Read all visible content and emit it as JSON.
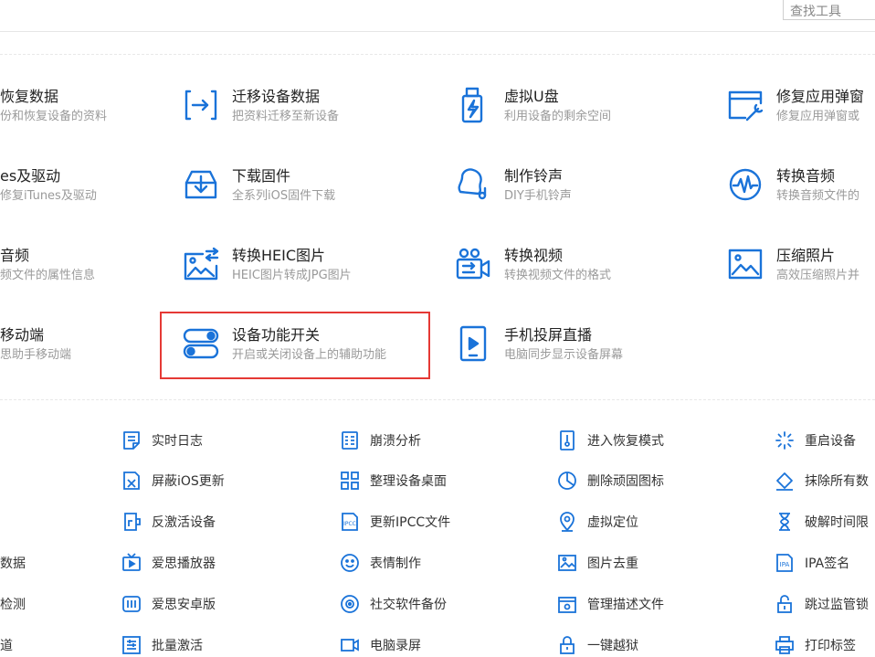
{
  "search": {
    "placeholder": "查找工具"
  },
  "tools": [
    {
      "title": "恢复数据",
      "sub": "份和恢复设备的资料",
      "icon": "none"
    },
    {
      "title": "迁移设备数据",
      "sub": "把资料迁移至新设备",
      "icon": "migrate-icon"
    },
    {
      "title": "虚拟U盘",
      "sub": "利用设备的剩余空间",
      "icon": "usb-drive-icon"
    },
    {
      "title": "修复应用弹窗",
      "sub": "修复应用弹窗或",
      "icon": "repair-window-icon"
    },
    {
      "title": "es及驱动",
      "sub": "修复iTunes及驱动",
      "icon": "none"
    },
    {
      "title": "下载固件",
      "sub": "全系列iOS固件下载",
      "icon": "download-firmware-icon"
    },
    {
      "title": "制作铃声",
      "sub": "DIY手机铃声",
      "icon": "bell-icon"
    },
    {
      "title": "转换音频",
      "sub": "转换音频文件的",
      "icon": "audio-wave-icon"
    },
    {
      "title": "音频",
      "sub": "频文件的属性信息",
      "icon": "none"
    },
    {
      "title": "转换HEIC图片",
      "sub": "HEIC图片转成JPG图片",
      "icon": "convert-image-icon"
    },
    {
      "title": "转换视频",
      "sub": "转换视频文件的格式",
      "icon": "convert-video-icon"
    },
    {
      "title": "压缩照片",
      "sub": "高效压缩照片并",
      "icon": "photo-icon"
    },
    {
      "title": "移动端",
      "sub": "思助手移动端",
      "icon": "none"
    },
    {
      "title": "设备功能开关",
      "sub": "开启或关闭设备上的辅助功能",
      "icon": "toggle-icon"
    },
    {
      "title": "手机投屏直播",
      "sub": "电脑同步显示设备屏幕",
      "icon": "screen-mirror-icon"
    }
  ],
  "small_tools": [
    {
      "label": "实时日志",
      "icon": "log-icon"
    },
    {
      "label": "崩溃分析",
      "icon": "crash-icon"
    },
    {
      "label": "进入恢复模式",
      "icon": "recovery-icon"
    },
    {
      "label": "重启设备",
      "icon": "restart-icon"
    },
    {
      "label": "屏蔽iOS更新",
      "icon": "block-update-icon"
    },
    {
      "label": "整理设备桌面",
      "icon": "desktop-grid-icon"
    },
    {
      "label": "删除顽固图标",
      "icon": "delete-icon-icon"
    },
    {
      "label": "抹除所有数",
      "icon": "erase-icon"
    },
    {
      "label": "反激活设备",
      "icon": "deactivate-icon"
    },
    {
      "label": "更新IPCC文件",
      "icon": "ipcc-icon"
    },
    {
      "label": "虚拟定位",
      "icon": "location-icon"
    },
    {
      "label": "破解时间限",
      "icon": "hourglass-icon"
    },
    {
      "label": "数据",
      "icon": "none"
    },
    {
      "label": "爱思播放器",
      "icon": "player-icon"
    },
    {
      "label": "表情制作",
      "icon": "emoji-icon"
    },
    {
      "label": "图片去重",
      "icon": "image-dedupe-icon"
    },
    {
      "label": "IPA签名",
      "icon": "ipa-icon"
    },
    {
      "label": "检测",
      "icon": "none"
    },
    {
      "label": "爱思安卓版",
      "icon": "android-icon"
    },
    {
      "label": "社交软件备份",
      "icon": "backup-icon"
    },
    {
      "label": "管理描述文件",
      "icon": "profile-icon"
    },
    {
      "label": "跳过监管锁",
      "icon": "unlock-icon"
    },
    {
      "label": "道",
      "icon": "none"
    },
    {
      "label": "批量激活",
      "icon": "batch-icon"
    },
    {
      "label": "电脑录屏",
      "icon": "record-icon"
    },
    {
      "label": "一键越狱",
      "icon": "jailbreak-icon"
    },
    {
      "label": "打印标签",
      "icon": "print-icon"
    }
  ],
  "colors": {
    "accent": "#1a73d9",
    "highlight": "#e53935"
  }
}
